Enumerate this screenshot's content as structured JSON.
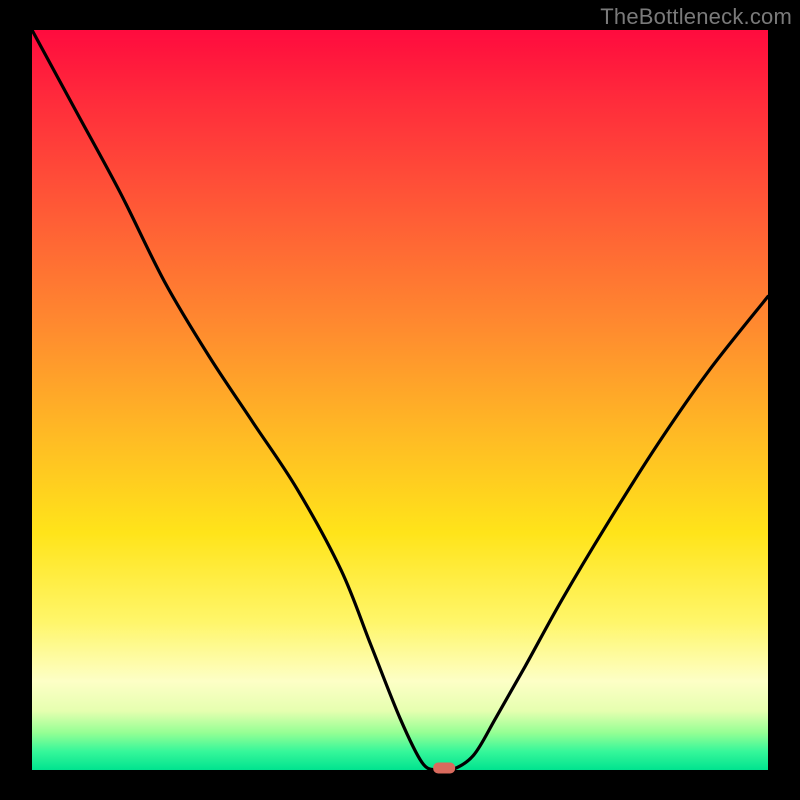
{
  "watermark": "TheBottleneck.com",
  "colors": {
    "frame_background": "#000000",
    "gradient_top": "#ff0b3e",
    "gradient_mid": "#ffe41a",
    "gradient_bottom": "#00e38f",
    "curve_stroke": "#000000",
    "marker_fill": "#d96a5d",
    "watermark_text": "#7a7a7a"
  },
  "chart_data": {
    "type": "line",
    "title": "",
    "xlabel": "",
    "ylabel": "",
    "xlim": [
      0,
      100
    ],
    "ylim": [
      0,
      100
    ],
    "x": [
      0,
      6,
      12,
      18,
      24,
      30,
      36,
      42,
      46,
      50,
      53,
      55,
      57,
      60,
      63,
      67,
      72,
      78,
      85,
      92,
      100
    ],
    "values": [
      100,
      89,
      78,
      66,
      56,
      47,
      38,
      27,
      17,
      7,
      1,
      0,
      0,
      2,
      7,
      14,
      23,
      33,
      44,
      54,
      64
    ],
    "min_point": {
      "x": 56,
      "y": 0
    },
    "annotations": []
  }
}
